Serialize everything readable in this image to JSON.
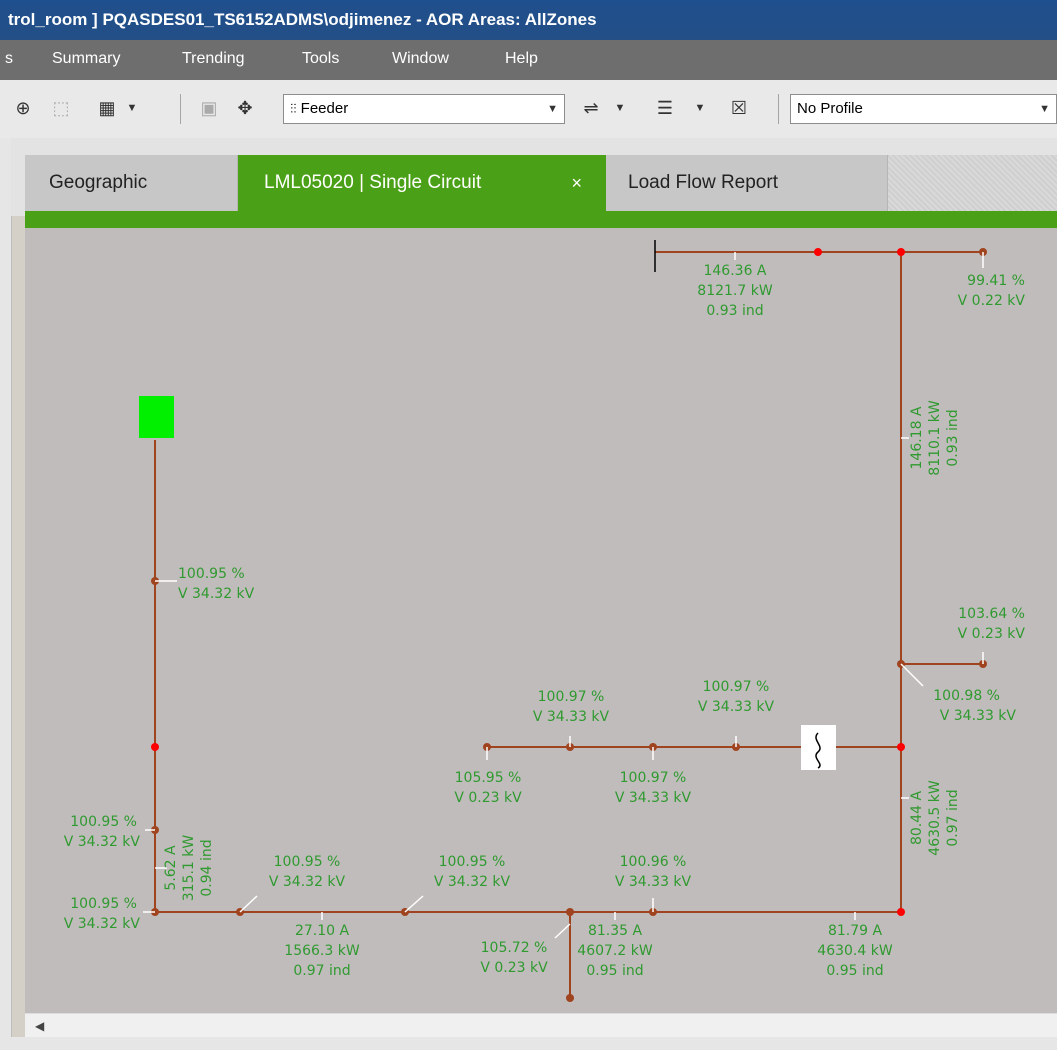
{
  "window": {
    "title": "trol_room ] PQASDES01_TS6152ADMS\\odjimenez - AOR Areas: AllZones"
  },
  "menu": {
    "items": [
      "s",
      "Summary",
      "Trending",
      "Tools",
      "Window",
      "Help"
    ]
  },
  "toolbar": {
    "layer_combo_value": "Feeder",
    "profile_combo_value": "No Profile"
  },
  "tabs": [
    {
      "label": "Geographic",
      "active": false
    },
    {
      "label": "LML05020 | Single Circuit",
      "active": true,
      "close": "×"
    },
    {
      "label": "Load Flow Report",
      "active": false
    }
  ],
  "colors": {
    "line": "#a0431f",
    "label_text": "#2f9a2f",
    "tab_active": "#4aa016",
    "source_box": "#00f000",
    "open_node": "#ff0000"
  },
  "labels": {
    "top_flow": [
      "146.36 A",
      "8121.7 kW",
      "0.93 ind"
    ],
    "top_right_volt": [
      "99.41 %",
      "V 0.22 kV"
    ],
    "right_flow": [
      "146.18 A",
      "8110.1 kW",
      "0.93 ind"
    ],
    "left_volt_1": [
      "100.95 %",
      "V 34.32 kV"
    ],
    "right_volt_1": [
      "103.64 %",
      "V 0.23 kV"
    ],
    "right_volt_2": [
      "100.98 %",
      "V 34.33 kV"
    ],
    "mid_volt_a": [
      "100.97 %",
      "V 34.33 kV"
    ],
    "mid_volt_b": [
      "100.97 %",
      "V 34.33 kV"
    ],
    "mid_volt_c": [
      "105.95 %",
      "V 0.23 kV"
    ],
    "mid_volt_d": [
      "100.97 %",
      "V 34.33 kV"
    ],
    "right_flow_2": [
      "80.44 A",
      "4630.5 kW",
      "0.97 ind"
    ],
    "left_volt_2": [
      "100.95 %",
      "V 34.32 kV"
    ],
    "left_flow": [
      "5.62 A",
      "315.1 kW",
      "0.94 ind"
    ],
    "left_volt_3": [
      "100.95 %",
      "V 34.32 kV"
    ],
    "bot_volt_a": [
      "100.95 %",
      "V 34.32 kV"
    ],
    "bot_volt_b": [
      "100.95 %",
      "V 34.32 kV"
    ],
    "bot_volt_c": [
      "100.96 %",
      "V 34.33 kV"
    ],
    "bot_flow_a": [
      "27.10 A",
      "1566.3 kW",
      "0.97 ind"
    ],
    "bot_volt_d": [
      "105.72 %",
      "V 0.23 kV"
    ],
    "bot_flow_b": [
      "81.35 A",
      "4607.2 kW",
      "0.95 ind"
    ],
    "bot_flow_c": [
      "81.79 A",
      "4630.4 kW",
      "0.95 ind"
    ]
  }
}
